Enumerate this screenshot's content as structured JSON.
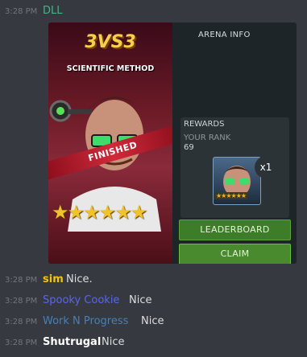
{
  "messages": [
    {
      "time": "3:28 PM",
      "author": "DLL",
      "author_color": "#43b581",
      "text": ""
    },
    {
      "time": "3:28 PM",
      "author": "sim",
      "author_color": "#f1c40f",
      "text": "Nice."
    },
    {
      "time": "3:28 PM",
      "author": "Spooky Cookie",
      "author_color": "#5865f2",
      "text": "Nice"
    },
    {
      "time": "3:28 PM",
      "author": "Work N Progress",
      "author_color": "#4a7fb5",
      "text": "Nice"
    },
    {
      "time": "3:28 PM",
      "author": "Shutrugal",
      "author_color": "#ffffff",
      "text": "Nice"
    }
  ],
  "embed": {
    "card": {
      "mode": "3VS3",
      "title": "SCIENTIFIC METHOD",
      "status": "FINISHED",
      "stars": "★★★★★★"
    },
    "panel": {
      "title": "ARENA INFO",
      "rewards_label": "REWARDS",
      "rank_label": "YOUR RANK",
      "rank_value": "69",
      "reward_qty": "x1",
      "reward_stars": "★★★★★★",
      "leaderboard_label": "LEADERBOARD",
      "claim_label": "CLAIM"
    }
  }
}
